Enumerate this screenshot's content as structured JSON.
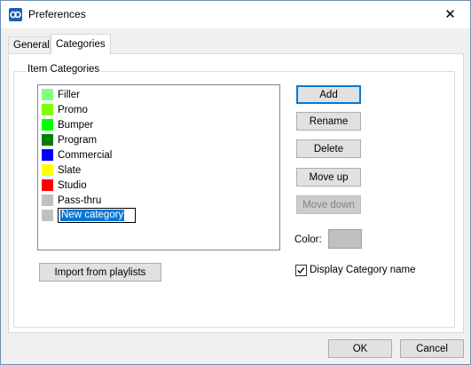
{
  "window": {
    "title": "Preferences",
    "close_glyph": "✕"
  },
  "tabs": [
    {
      "label": "General",
      "active": false
    },
    {
      "label": "Categories",
      "active": true
    }
  ],
  "group": {
    "label": "Item Categories"
  },
  "categories": [
    {
      "label": "Filler",
      "color": "#80ff80"
    },
    {
      "label": "Promo",
      "color": "#80ff00"
    },
    {
      "label": "Bumper",
      "color": "#00ff00"
    },
    {
      "label": "Program",
      "color": "#008000"
    },
    {
      "label": "Commercial",
      "color": "#0000ff"
    },
    {
      "label": "Slate",
      "color": "#ffff00"
    },
    {
      "label": "Studio",
      "color": "#ff0000"
    },
    {
      "label": "Pass-thru",
      "color": "#c0c0c0"
    }
  ],
  "editing": {
    "value": "New category",
    "color": "#c0c0c0"
  },
  "buttons": {
    "add": "Add",
    "rename": "Rename",
    "delete": "Delete",
    "move_up": "Move up",
    "move_down": "Move down",
    "import": "Import from playlists",
    "ok": "OK",
    "cancel": "Cancel"
  },
  "color_picker": {
    "label": "Color:",
    "value": "#c0c0c0"
  },
  "display_name": {
    "label": "Display Category name",
    "checked": true
  }
}
